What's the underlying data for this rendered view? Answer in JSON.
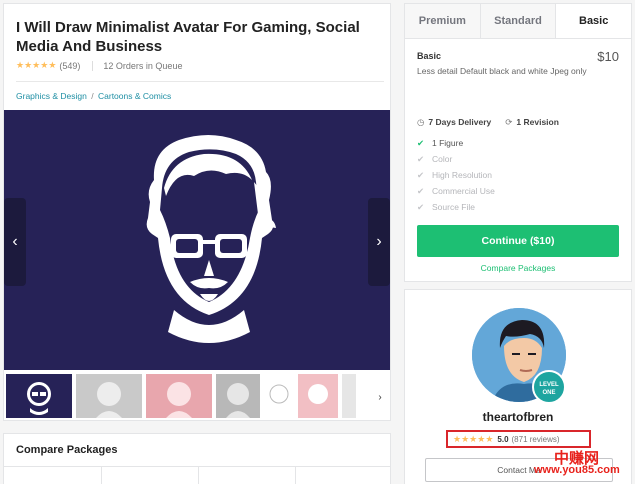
{
  "gig": {
    "title": "I Will Draw Minimalist Avatar For Gaming, Social Media And Business",
    "rating_count": "(549)",
    "orders_in_queue": "12 Orders in Queue",
    "breadcrumb": [
      "Graphics & Design",
      "Cartoons & Comics"
    ],
    "breadcrumb_sep": "/"
  },
  "gallery": {
    "prev_glyph": "‹",
    "next_glyph": "›",
    "thumb_next_glyph": "›"
  },
  "compare_section": {
    "title": "Compare Packages"
  },
  "packages": {
    "tabs": [
      "Premium",
      "Standard",
      "Basic"
    ],
    "active_tab": "Basic",
    "name": "Basic",
    "price": "$10",
    "description": "Less detail Default black and white Jpeg only",
    "delivery": "7 Days Delivery",
    "revisions": "1 Revision",
    "features": [
      {
        "label": "1 Figure",
        "included": true
      },
      {
        "label": "Color",
        "included": false
      },
      {
        "label": "High Resolution",
        "included": false
      },
      {
        "label": "Commercial Use",
        "included": false
      },
      {
        "label": "Source File",
        "included": false
      }
    ],
    "continue_label": "Continue ($10)",
    "compare_link": "Compare Packages"
  },
  "seller": {
    "username": "theartofbren",
    "level_line1": "LEVEL",
    "level_line2": "ONE",
    "score": "5.0",
    "reviews": "(871 reviews)",
    "contact_label": "Contact Me"
  },
  "watermark": {
    "cn": "中赚网",
    "url": "www.you85.com"
  },
  "colors": {
    "accent_green": "#1dbf73",
    "hero_bg": "#262257",
    "star": "#ffbe5b",
    "highlight_red": "#d9262b",
    "link_teal": "#1f8fa4",
    "level_badge": "#1ea5a0"
  },
  "icons": {
    "delivery": "clock-icon",
    "revision": "refresh-icon",
    "feature": "check-icon",
    "rating": "star-icon"
  }
}
